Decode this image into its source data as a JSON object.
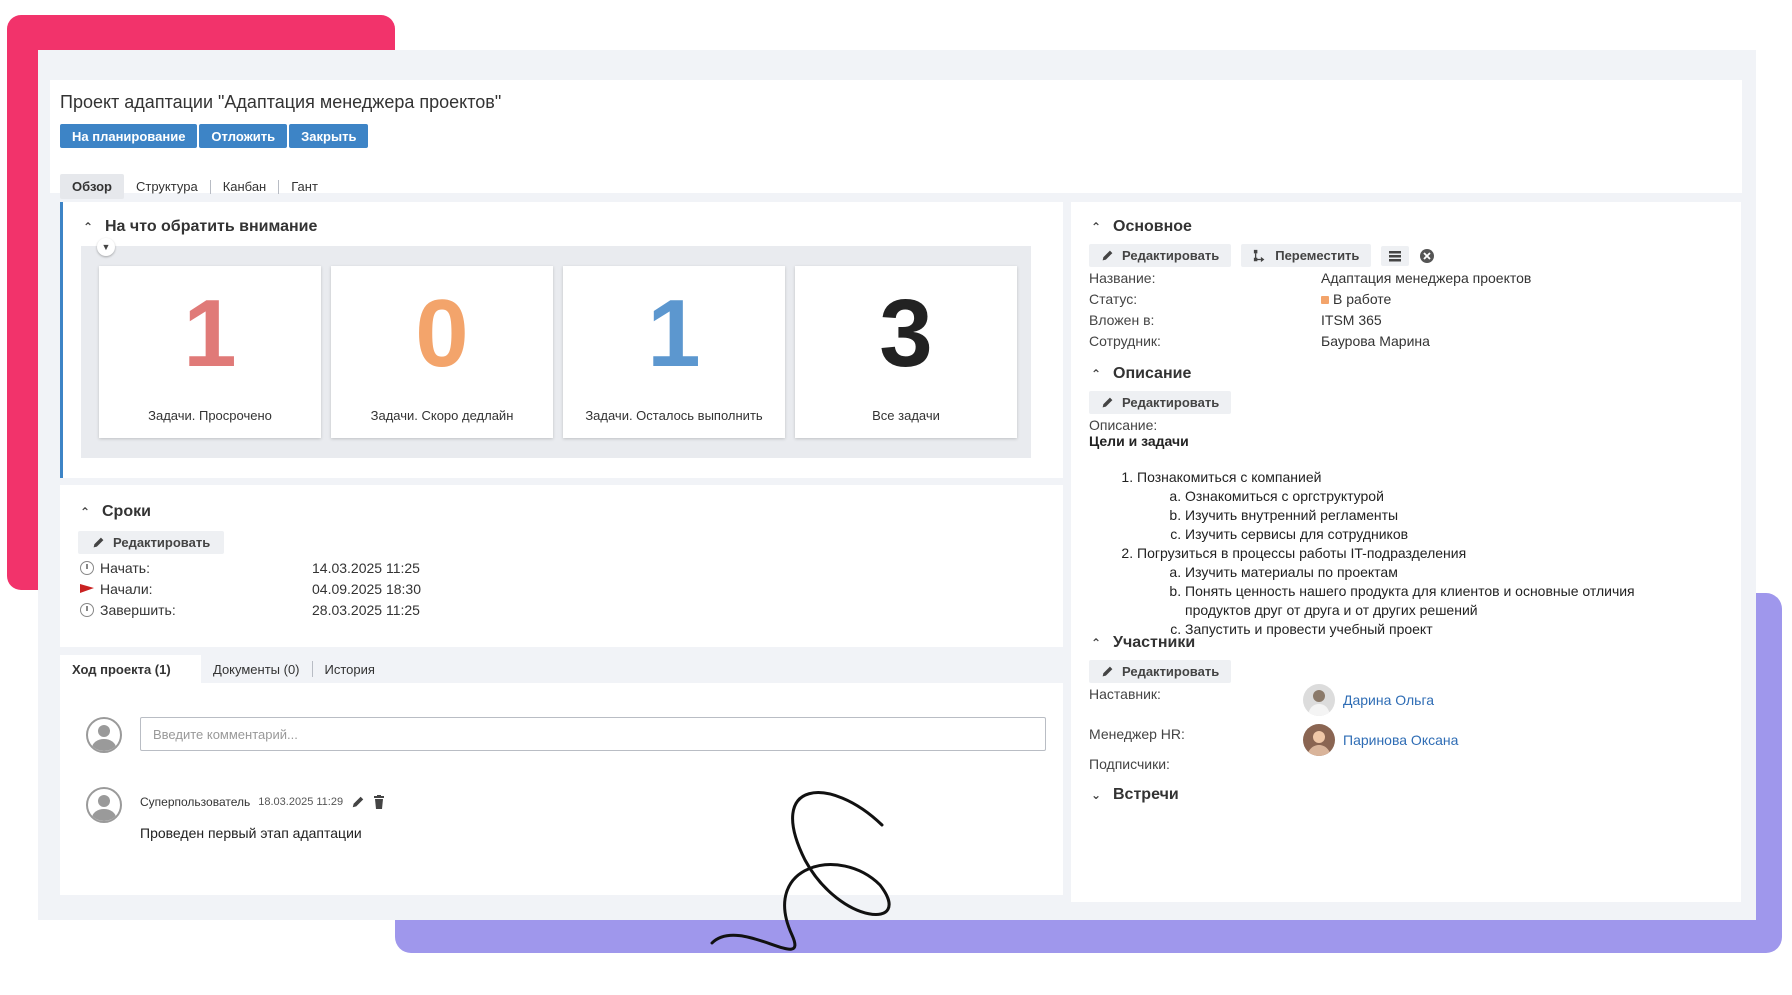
{
  "project": {
    "title": "Проект адаптации \"Адаптация менеджера проектов\"",
    "actions": [
      "На планирование",
      "Отложить",
      "Закрыть"
    ],
    "tabs": [
      "Обзор",
      "Структура",
      "Канбан",
      "Гант"
    ]
  },
  "attention": {
    "title": "На что обратить внимание",
    "stats": [
      {
        "value": "1",
        "label": "Задачи. Просрочено",
        "color": "#e07a78"
      },
      {
        "value": "0",
        "label": "Задачи. Скоро дедлайн",
        "color": "#f3a46b"
      },
      {
        "value": "1",
        "label": "Задачи. Осталось выполнить",
        "color": "#5c97cf"
      },
      {
        "value": "3",
        "label": "Все задачи",
        "color": "#222222"
      }
    ]
  },
  "deadlines": {
    "title": "Сроки",
    "edit_label": "Редактировать",
    "rows": [
      {
        "label": "Начать:",
        "value": "14.03.2025 11:25"
      },
      {
        "label": "Начали:",
        "value": "04.09.2025 18:30"
      },
      {
        "label": "Завершить:",
        "value": "28.03.2025 11:25"
      }
    ]
  },
  "progress": {
    "tabs": [
      "Ход проекта (1)",
      "Документы (0)",
      "История"
    ],
    "comment_placeholder": "Введите комментарий...",
    "comment": {
      "author": "Суперпользователь",
      "time": "18.03.2025 11:29",
      "text": "Проведен первый этап адаптации"
    }
  },
  "main_info": {
    "title": "Основное",
    "edit_label": "Редактировать",
    "move_label": "Переместить",
    "fields": [
      {
        "label": "Название:",
        "value": "Адаптация менеджера проектов"
      },
      {
        "label": "Статус:",
        "value": "В работе"
      },
      {
        "label": "Вложен в:",
        "value": "ITSM 365"
      },
      {
        "label": "Сотрудник:",
        "value": "Баурова Марина"
      }
    ],
    "status_color": "#f3a46b"
  },
  "description": {
    "title": "Описание",
    "edit_label": "Редактировать",
    "label": "Описание:",
    "heading": "Цели и задачи",
    "items": [
      {
        "text": "Познакомиться с компанией",
        "sub": [
          "Ознакомиться с оргструктурой",
          "Изучить внутренний регламенты",
          "Изучить сервисы для сотрудников"
        ]
      },
      {
        "text": "Погрузиться в процессы работы IT-подразделения",
        "sub": [
          "Изучить материалы по проектам",
          "Понять ценность нашего продукта для клиентов и основные отличия продуктов друг от друга и от других решений",
          "Запустить и провести учебный проект"
        ]
      }
    ]
  },
  "participants": {
    "title": "Участники",
    "edit_label": "Редактировать",
    "mentor_label": "Наставник:",
    "mentor": "Дарина Ольга",
    "hr_label": "Менеджер HR:",
    "hr": "Паринова Оксана",
    "subscribers_label": "Подписчики:"
  },
  "meetings": {
    "title": "Встречи"
  }
}
